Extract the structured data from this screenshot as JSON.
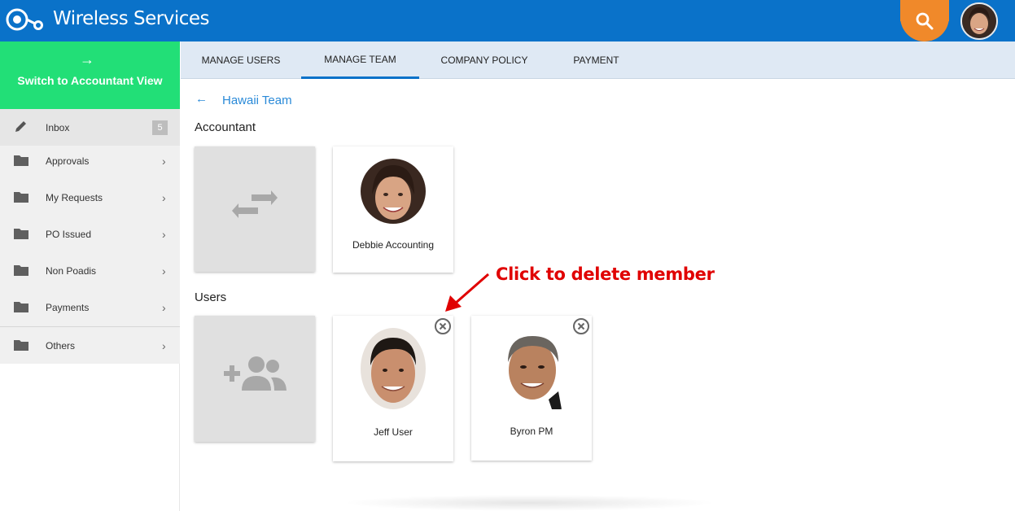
{
  "app": {
    "title": "Wireless Services"
  },
  "header": {
    "search_icon": "search-icon",
    "avatar_icon": "user-avatar"
  },
  "sidebar": {
    "switch_label": "Switch to Accountant View",
    "switch_arrow": "→",
    "items": [
      {
        "label": "Inbox",
        "icon": "pencil-icon",
        "badge": "5"
      },
      {
        "label": "Approvals",
        "icon": "folder-icon",
        "chevron": "›"
      },
      {
        "label": "My Requests",
        "icon": "folder-icon",
        "chevron": "›"
      },
      {
        "label": "PO Issued",
        "icon": "folder-icon",
        "chevron": "›"
      },
      {
        "label": "Non Poadis",
        "icon": "folder-icon",
        "chevron": "›"
      },
      {
        "label": "Payments",
        "icon": "folder-icon",
        "chevron": "›"
      },
      {
        "label": "Others",
        "icon": "folder-icon",
        "chevron": "›"
      }
    ]
  },
  "tabs": [
    {
      "label": "MANAGE USERS",
      "active": false
    },
    {
      "label": "MANAGE TEAM",
      "active": true
    },
    {
      "label": "COMPANY POLICY",
      "active": false
    },
    {
      "label": "PAYMENT",
      "active": false
    }
  ],
  "main": {
    "back_arrow": "←",
    "team_name": "Hawaii Team",
    "accountant_section": "Accountant",
    "users_section": "Users",
    "accountant": {
      "name": "Debbie Accounting"
    },
    "users": [
      {
        "name": "Jeff User"
      },
      {
        "name": "Byron PM"
      }
    ]
  },
  "annotation": {
    "text": "Click to delete member"
  },
  "colors": {
    "header": "#0a72c9",
    "switch_button": "#22df77",
    "search_button": "#f0892a",
    "link": "#2a8ad8",
    "annotation": "#e00000"
  }
}
